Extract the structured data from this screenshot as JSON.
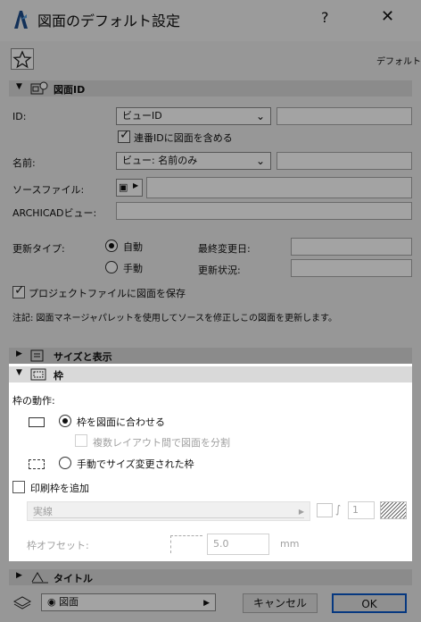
{
  "window": {
    "title": "図面のデフォルト設定",
    "help": "?",
    "close": "✕"
  },
  "toolbar": {
    "favorite_icon": "star-icon",
    "default_label": "デフォルト"
  },
  "drawing_id_section": {
    "title": "図面ID",
    "id_label": "ID:",
    "id_value": "ビューID",
    "include_serial_label": "連番IDに図面を含める",
    "name_label": "名前:",
    "name_value": "ビュー: 名前のみ",
    "source_file_label": "ソースファイル:",
    "archicad_view_label": "ARCHICADビュー:",
    "update_type_label": "更新タイプ:",
    "update_auto": "自動",
    "update_manual": "手動",
    "last_changed_label": "最終変更日:",
    "update_status_label": "更新状況:",
    "save_drawing_label": "プロジェクトファイルに図面を保存",
    "note": "注記:   図面マネージャパレットを使用してソースを修正しこの図面を更新します。"
  },
  "size_section": {
    "title": "サイズと表示"
  },
  "frame_section": {
    "title": "枠",
    "behavior_label": "枠の動作:",
    "fit_option": "枠を図面に合わせる",
    "split_option": "複数レイアウト間で図面を分割",
    "manual_option": "手動でサイズ変更された枠",
    "print_frame_label": "印刷枠を追加",
    "line_type": "実線",
    "pen_number": "1",
    "offset_label": "枠オフセット:",
    "offset_value": "5.0",
    "offset_unit": "mm"
  },
  "title_section": {
    "title": "タイトル"
  },
  "footer": {
    "layer_value": "図面",
    "cancel_label": "キャンセル",
    "ok_label": "OK"
  }
}
